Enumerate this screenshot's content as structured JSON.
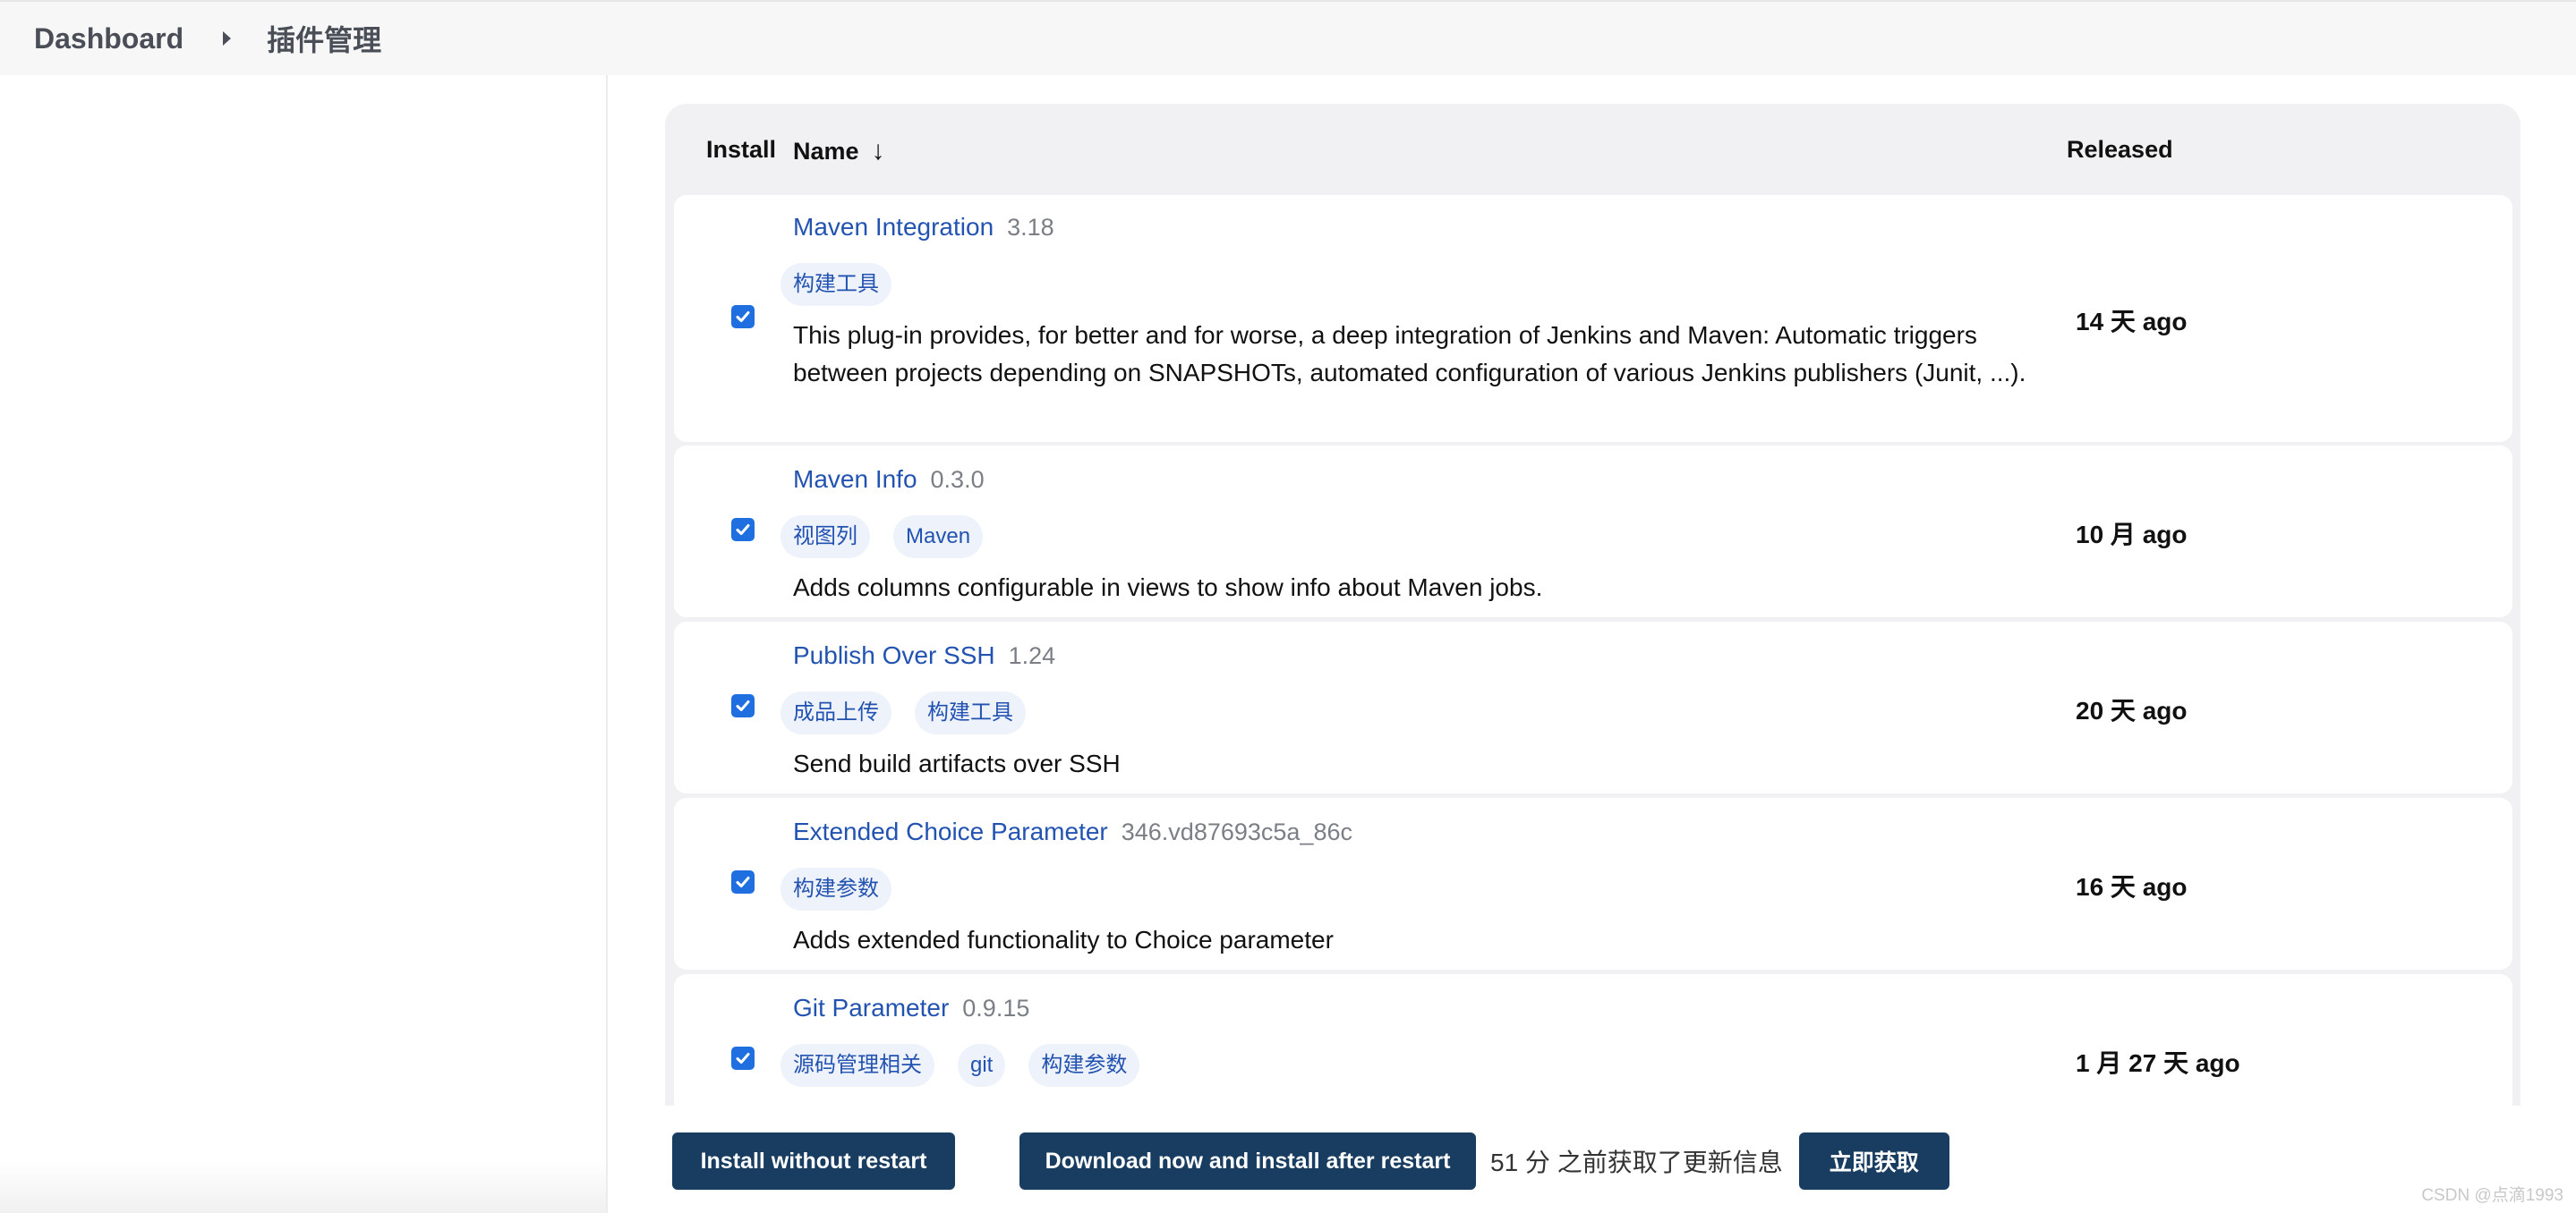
{
  "breadcrumb": {
    "root": "Dashboard",
    "current": "插件管理"
  },
  "table": {
    "headers": {
      "install": "Install",
      "name": "Name",
      "sort_arrow": "↓",
      "released": "Released"
    },
    "rows": [
      {
        "checked": true,
        "name": "Maven Integration",
        "version": "3.18",
        "tags": [
          "构建工具"
        ],
        "description": "This plug-in provides, for better and for worse, a deep integration of Jenkins and Maven: Automatic triggers between projects depending on SNAPSHOTs, automated configuration of various Jenkins publishers (Junit, ...).",
        "released": "14 天 ago"
      },
      {
        "checked": true,
        "name": "Maven Info",
        "version": "0.3.0",
        "tags": [
          "视图列",
          "Maven"
        ],
        "description": "Adds columns configurable in views to show info about Maven jobs.",
        "released": "10 月 ago"
      },
      {
        "checked": true,
        "name": "Publish Over SSH",
        "version": "1.24",
        "tags": [
          "成品上传",
          "构建工具"
        ],
        "description": "Send build artifacts over SSH",
        "released": "20 天 ago"
      },
      {
        "checked": true,
        "name": "Extended Choice Parameter",
        "version": "346.vd87693c5a_86c",
        "tags": [
          "构建参数"
        ],
        "description": "Adds extended functionality to Choice parameter",
        "released": "16 天 ago"
      },
      {
        "checked": true,
        "name": "Git Parameter",
        "version": "0.9.15",
        "tags": [
          "源码管理相关",
          "git",
          "构建参数"
        ],
        "description": "",
        "released": "1 月 27 天 ago"
      }
    ]
  },
  "footer": {
    "install_without_restart": "Install without restart",
    "download_install_after_restart": "Download now and install after restart",
    "update_info": "51 分 之前获取了更新信息",
    "fetch_now": "立即获取"
  },
  "watermark": "CSDN @点滴1993",
  "colors": {
    "link": "#2353b0",
    "button": "#193d61",
    "checkbox": "#1f6fe0",
    "tag_bg": "#eef2fb"
  }
}
